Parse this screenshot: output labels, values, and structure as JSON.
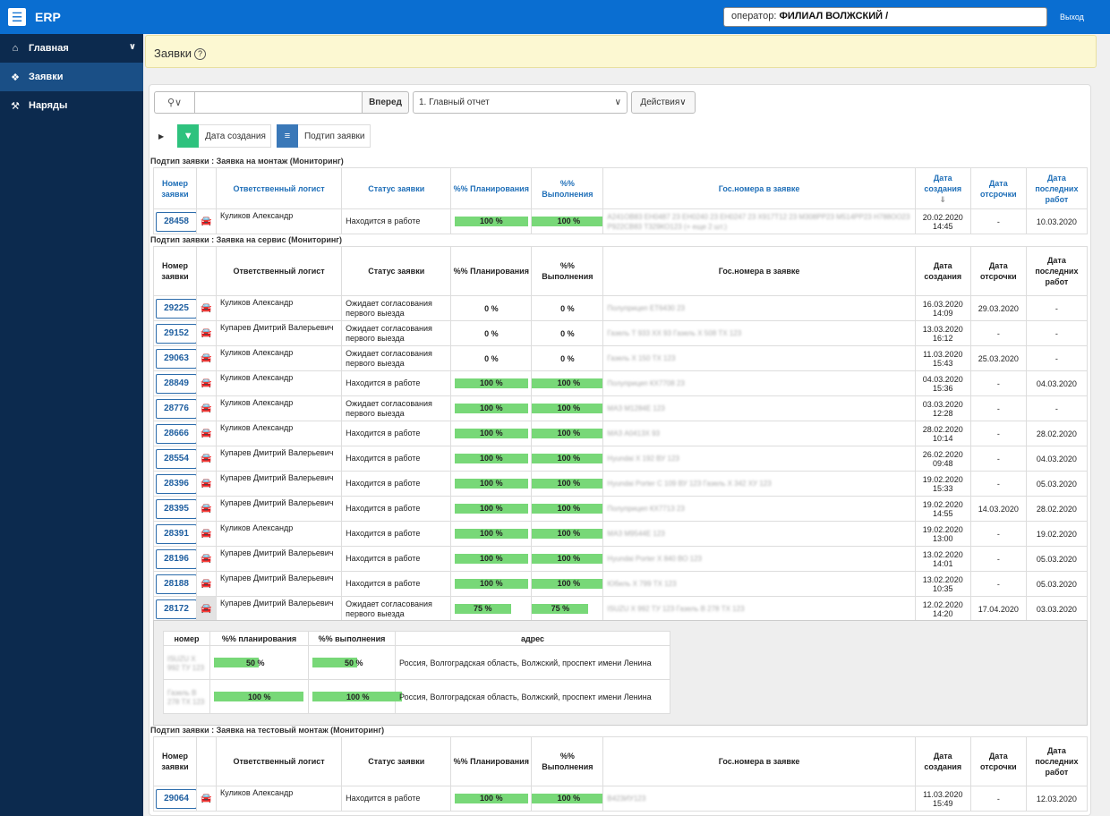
{
  "topbar": {
    "title": "ERP",
    "operator_label": "оператор:",
    "operator_value": "ФИЛИАЛ ВОЛЖСКИЙ /",
    "logout": "Выход",
    "brand_color": "#0a6ed1"
  },
  "sidebar": {
    "items": [
      {
        "label": "Главная",
        "icon": "home-icon"
      },
      {
        "label": "Заявки",
        "icon": "cubes-icon"
      },
      {
        "label": "Наряды",
        "icon": "hammer-icon"
      }
    ]
  },
  "page": {
    "title": "Заявки"
  },
  "toolbar": {
    "go": "Вперед",
    "report": "1. Главный отчет",
    "actions": "Действия"
  },
  "filters": {
    "date": "Дата создания",
    "subtype": "Подтип заявки"
  },
  "columns": {
    "num": "Номер заявки",
    "logist": "Ответственный логист",
    "status": "Статус заявки",
    "plan": "%% Планирования",
    "done": "%% Выполнения",
    "plates": "Гос.номера в заявке",
    "created": "Дата создания",
    "delay": "Дата отсрочки",
    "last": "Дата последних работ"
  },
  "groups": [
    {
      "title": "Подтип заявки : Заявка на монтаж (Мониторинг)",
      "rows": [
        {
          "num": "28458",
          "logist": "Куликов Александр",
          "status": "Находится в работе",
          "plan": "100 %",
          "done": "100 %",
          "plates": "А241ОВ83 ЕН0487 23 ЕН0240 23 ЕН0247 23 Х917Т12 23 М308РР23 М514РР23 Н788ОО23 Р922СВ83 Т329КО123 (+ еще 2 шт.)",
          "created_d": "20.02.2020",
          "created_t": "14:45",
          "delay": "-",
          "last": "10.03.2020"
        }
      ]
    },
    {
      "title": "Подтип заявки : Заявка на сервис (Мониторинг)",
      "rows": [
        {
          "num": "29225",
          "logist": "Куликов Александр",
          "status": "Ожидает согласования первого выезда",
          "plan": "0 %",
          "done": "0 %",
          "plates": "Полуприцеп ЕТ6430 23",
          "created_d": "16.03.2020",
          "created_t": "14:09",
          "delay": "29.03.2020",
          "last": "-"
        },
        {
          "num": "29152",
          "logist": "Купарев Дмитрий Валерьевич",
          "status": "Ожидает согласования первого выезда",
          "plan": "0 %",
          "done": "0 %",
          "plates": "Газель Т 933 ХХ 93 Газель Х 508 ТХ 123",
          "created_d": "13.03.2020",
          "created_t": "16:12",
          "delay": "-",
          "last": "-"
        },
        {
          "num": "29063",
          "logist": "Куликов Александр",
          "status": "Ожидает согласования первого выезда",
          "plan": "0 %",
          "done": "0 %",
          "plates": "Газель Х 150 ТХ 123",
          "created_d": "11.03.2020",
          "created_t": "15:43",
          "delay": "25.03.2020",
          "last": "-"
        },
        {
          "num": "28849",
          "logist": "Куликов Александр",
          "status": "Находится в работе",
          "plan": "100 %",
          "done": "100 %",
          "plates": "Полуприцеп КХ7708 23",
          "created_d": "04.03.2020",
          "created_t": "15:36",
          "delay": "-",
          "last": "04.03.2020"
        },
        {
          "num": "28776",
          "logist": "Куликов Александр",
          "status": "Ожидает согласования первого выезда",
          "plan": "100 %",
          "done": "100 %",
          "plates": "МАЗ М1284Е 123",
          "created_d": "03.03.2020",
          "created_t": "12:28",
          "delay": "-",
          "last": "-"
        },
        {
          "num": "28666",
          "logist": "Куликов Александр",
          "status": "Находится в работе",
          "plan": "100 %",
          "done": "100 %",
          "plates": "МАЗ А0413Х 93",
          "created_d": "28.02.2020",
          "created_t": "10:14",
          "delay": "-",
          "last": "28.02.2020"
        },
        {
          "num": "28554",
          "logist": "Купарев Дмитрий Валерьевич",
          "status": "Находится в работе",
          "plan": "100 %",
          "done": "100 %",
          "plates": "Hyundai Х 192 ВУ 123",
          "created_d": "26.02.2020",
          "created_t": "09:48",
          "delay": "-",
          "last": "04.03.2020"
        },
        {
          "num": "28396",
          "logist": "Купарев Дмитрий Валерьевич",
          "status": "Находится в работе",
          "plan": "100 %",
          "done": "100 %",
          "plates": "Hyundai Porter С 109 ВУ 123 Газель Х 342 ХУ 123",
          "created_d": "19.02.2020",
          "created_t": "15:33",
          "delay": "-",
          "last": "05.03.2020"
        },
        {
          "num": "28395",
          "logist": "Купарев Дмитрий Валерьевич",
          "status": "Находится в работе",
          "plan": "100 %",
          "done": "100 %",
          "plates": "Полуприцеп КХ7713 23",
          "created_d": "19.02.2020",
          "created_t": "14:55",
          "delay": "14.03.2020",
          "last": "28.02.2020"
        },
        {
          "num": "28391",
          "logist": "Куликов Александр",
          "status": "Находится в работе",
          "plan": "100 %",
          "done": "100 %",
          "plates": "МАЗ М9544Е 123",
          "created_d": "19.02.2020",
          "created_t": "13:00",
          "delay": "-",
          "last": "19.02.2020"
        },
        {
          "num": "28196",
          "logist": "Купарев Дмитрий Валерьевич",
          "status": "Находится в работе",
          "plan": "100 %",
          "done": "100 %",
          "plates": "Hyundai Porter Х 840 ВО 123",
          "created_d": "13.02.2020",
          "created_t": "14:01",
          "delay": "-",
          "last": "05.03.2020"
        },
        {
          "num": "28188",
          "logist": "Купарев Дмитрий Валерьевич",
          "status": "Находится в работе",
          "plan": "100 %",
          "done": "100 %",
          "plates": "Юбиль Х 799 ТХ 123",
          "created_d": "13.02.2020",
          "created_t": "10:35",
          "delay": "-",
          "last": "05.03.2020"
        },
        {
          "num": "28172",
          "logist": "Купарев Дмитрий Валерьевич",
          "status": "Ожидает согласования первого выезда",
          "plan": "75 %",
          "done": "75 %",
          "plates": "ISUZU Х 992 ТУ 123 Газель В 278 ТХ 123",
          "created_d": "12.02.2020",
          "created_t": "14:20",
          "delay": "17.04.2020",
          "last": "03.03.2020"
        }
      ]
    },
    {
      "title": "Подтип заявки : Заявка на тестовый монтаж (Мониторинг)",
      "rows": [
        {
          "num": "29064",
          "logist": "Куликов Александр",
          "status": "Находится в работе",
          "plan": "100 %",
          "done": "100 %",
          "plates": "В423ИУ123",
          "created_d": "11.03.2020",
          "created_t": "15:49",
          "delay": "-",
          "last": "12.03.2020"
        }
      ]
    }
  ],
  "detail": {
    "headers": {
      "num": "номер",
      "plan": "%% планирования",
      "done": "%% выполнения",
      "addr": "адрес"
    },
    "rows": [
      {
        "num": "ISUZU Х 992 ТУ 123",
        "plan_text": "50 %",
        "plan_value": 50,
        "done_text": "50 %",
        "done_value": 50,
        "addr": "Россия, Волгоградская область, Волжский, проспект имени Ленина"
      },
      {
        "num": "Газель В 278 ТХ 123",
        "plan_text": "100 %",
        "plan_value": 100,
        "done_text": "100 %",
        "done_value": 100,
        "addr": "Россия, Волгоградская область, Волжский, проспект имени Ленина"
      }
    ]
  }
}
